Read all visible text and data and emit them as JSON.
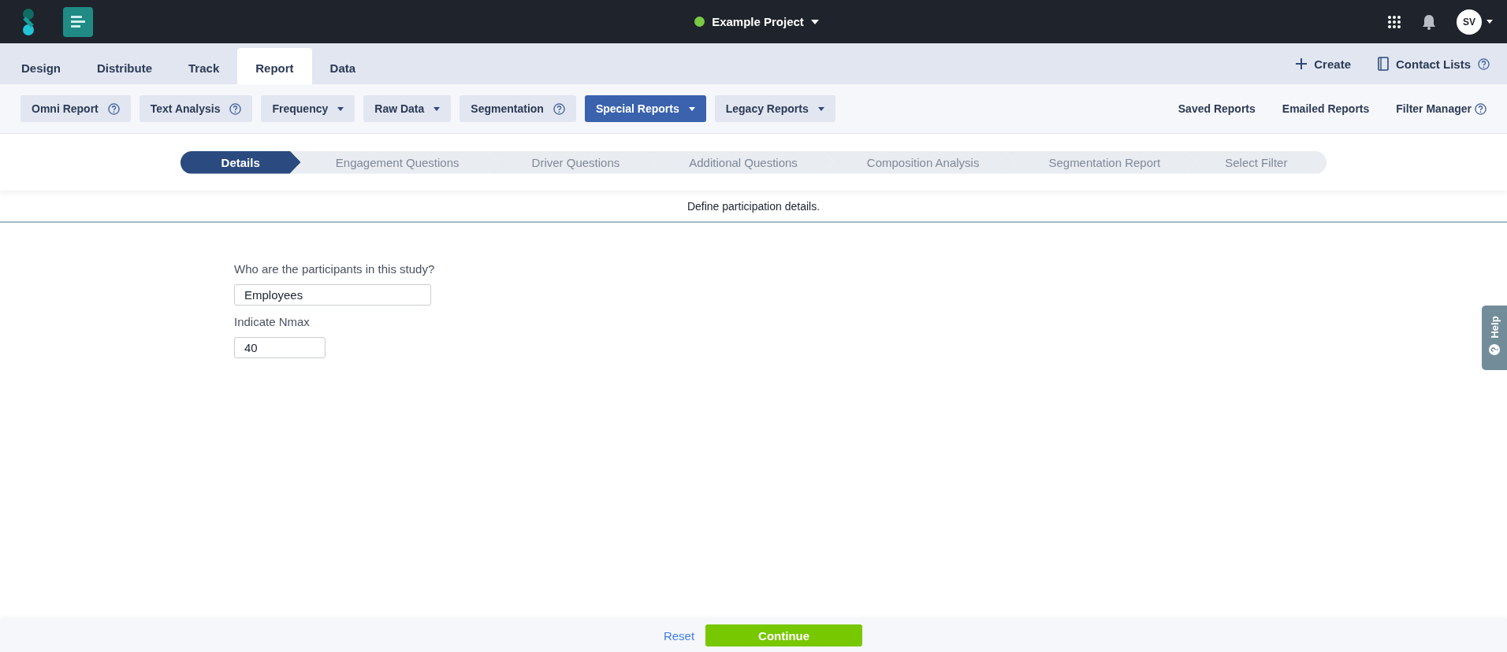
{
  "topbar": {
    "project": {
      "name": "Example Project",
      "color": "#7ac943"
    },
    "user_initials": "SV"
  },
  "tabs": [
    {
      "label": "Design",
      "selected": false
    },
    {
      "label": "Distribute",
      "selected": false
    },
    {
      "label": "Track",
      "selected": false
    },
    {
      "label": "Report",
      "selected": true
    },
    {
      "label": "Data",
      "selected": false
    }
  ],
  "tab_actions": [
    {
      "label": "Create",
      "kind": "plus"
    },
    {
      "label": "Contact Lists",
      "kind": "book"
    }
  ],
  "report_buttons": [
    {
      "label": "Omni Report",
      "kind": "help",
      "selected": false
    },
    {
      "label": "Text Analysis",
      "kind": "help",
      "selected": false
    },
    {
      "label": "Frequency",
      "kind": "dropdown",
      "selected": false
    },
    {
      "label": "Raw Data",
      "kind": "dropdown",
      "selected": false
    },
    {
      "label": "Segmentation",
      "kind": "help",
      "selected": false
    },
    {
      "label": "Special Reports",
      "kind": "dropdown",
      "selected": true
    },
    {
      "label": "Legacy Reports",
      "kind": "dropdown",
      "selected": false
    }
  ],
  "report_links": [
    {
      "label": "Saved Reports",
      "kind": "plain"
    },
    {
      "label": "Emailed Reports",
      "kind": "plain"
    },
    {
      "label": "Filter Manager",
      "kind": "help"
    }
  ],
  "steps": [
    {
      "label": "Details",
      "selected": true
    },
    {
      "label": "Engagement Questions",
      "selected": false
    },
    {
      "label": "Driver Questions",
      "selected": false
    },
    {
      "label": "Additional Questions",
      "selected": false
    },
    {
      "label": "Composition Analysis",
      "selected": false
    },
    {
      "label": "Segmentation Report",
      "selected": false
    },
    {
      "label": "Select Filter",
      "selected": false
    }
  ],
  "instruction": "Define participation details.",
  "fields": [
    {
      "label": "Who are the participants in this study?",
      "value": "Employees",
      "kind": "wide"
    },
    {
      "label": "Indicate Nmax",
      "value": "40",
      "kind": "narrow"
    }
  ],
  "help_tab": "Help",
  "footer": {
    "reset": "Reset",
    "continue": "Continue"
  }
}
